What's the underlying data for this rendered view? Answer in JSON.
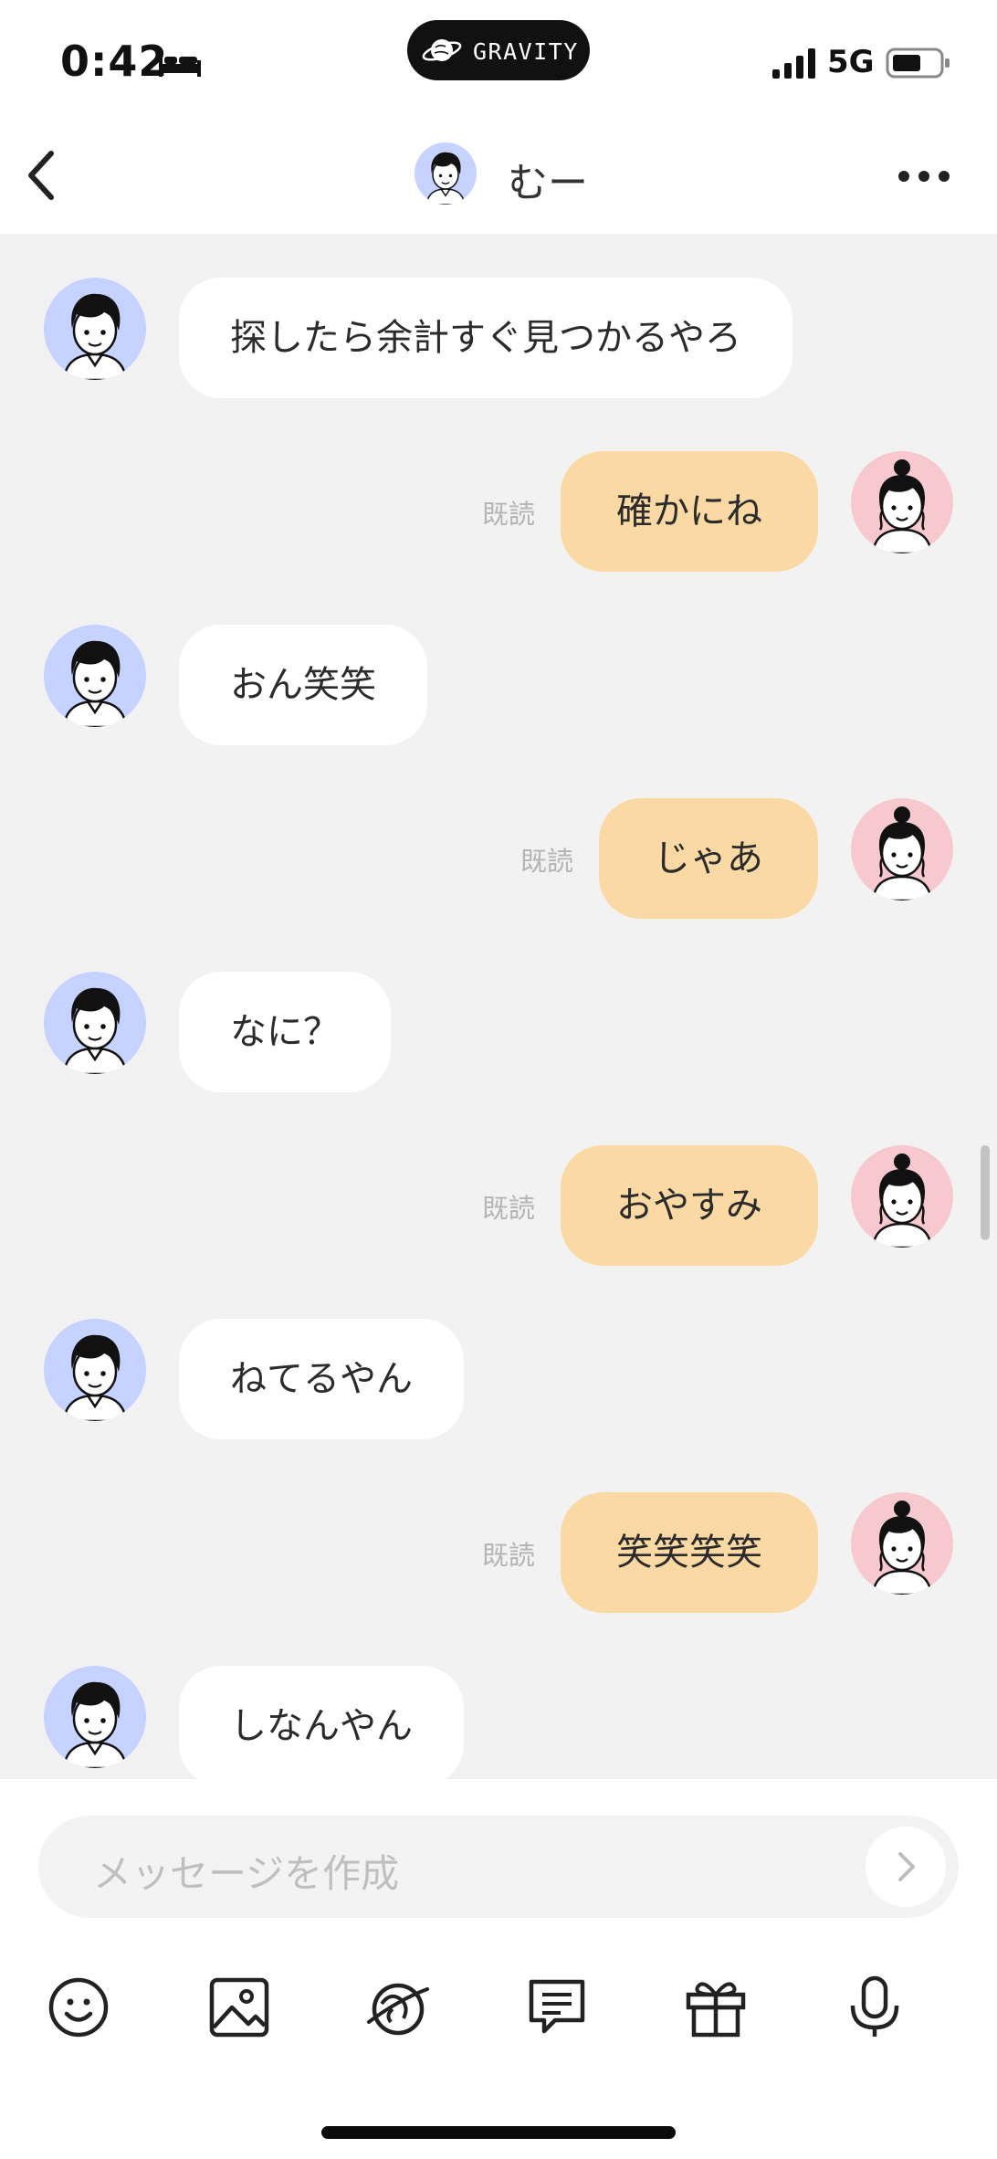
{
  "status_bar": {
    "time": "0:42",
    "network": "5G",
    "island_label": "GRAVITY"
  },
  "header": {
    "name": "むー"
  },
  "messages": [
    {
      "side": "left",
      "text": "探したら余計すぐ見つかるやろ"
    },
    {
      "side": "right",
      "text": "確かにね",
      "read": "既読"
    },
    {
      "side": "left",
      "text": "おん笑笑"
    },
    {
      "side": "right",
      "text": "じゃあ",
      "read": "既読"
    },
    {
      "side": "left",
      "text": "なに？"
    },
    {
      "side": "right",
      "text": "おやすみ",
      "read": "既読"
    },
    {
      "side": "left",
      "text": "ねてるやん"
    },
    {
      "side": "right",
      "text": "笑笑笑笑",
      "read": "既読"
    },
    {
      "side": "left",
      "text": "しなんやん"
    }
  ],
  "composer": {
    "placeholder": "メッセージを作成"
  },
  "toolbar": {
    "icons": [
      "emoji-icon",
      "image-icon",
      "planet-icon",
      "template-message-icon",
      "gift-icon",
      "microphone-icon"
    ]
  },
  "colors": {
    "sent_bubble": "#fbd9a4",
    "received_bubble": "#ffffff",
    "chat_background": "#f2f2f3",
    "avatar_male_bg": "#c6d2ff",
    "avatar_female_bg": "#f7c9cf"
  }
}
